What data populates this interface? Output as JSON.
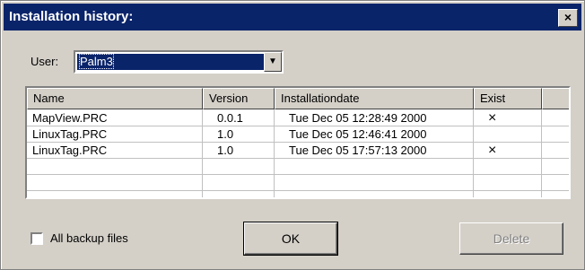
{
  "window": {
    "title": "Installation history:",
    "close_glyph": "×"
  },
  "user": {
    "label": "User:",
    "selected": "Palm3",
    "arrow_glyph": "▼"
  },
  "table": {
    "columns": [
      "Name",
      "Version",
      "Installationdate",
      "Exist"
    ],
    "rows": [
      {
        "name": "MapView.PRC",
        "version": "0.0.1",
        "date": "Tue Dec 05 12:28:49 2000",
        "exist": "×"
      },
      {
        "name": "LinuxTag.PRC",
        "version": "1.0",
        "date": "Tue Dec 05 12:46:41 2000",
        "exist": ""
      },
      {
        "name": "LinuxTag.PRC",
        "version": "1.0",
        "date": "Tue Dec 05 17:57:13 2000",
        "exist": "×"
      }
    ]
  },
  "backup": {
    "label": "All backup files",
    "checked": false
  },
  "buttons": {
    "ok": "OK",
    "delete": "Delete"
  }
}
